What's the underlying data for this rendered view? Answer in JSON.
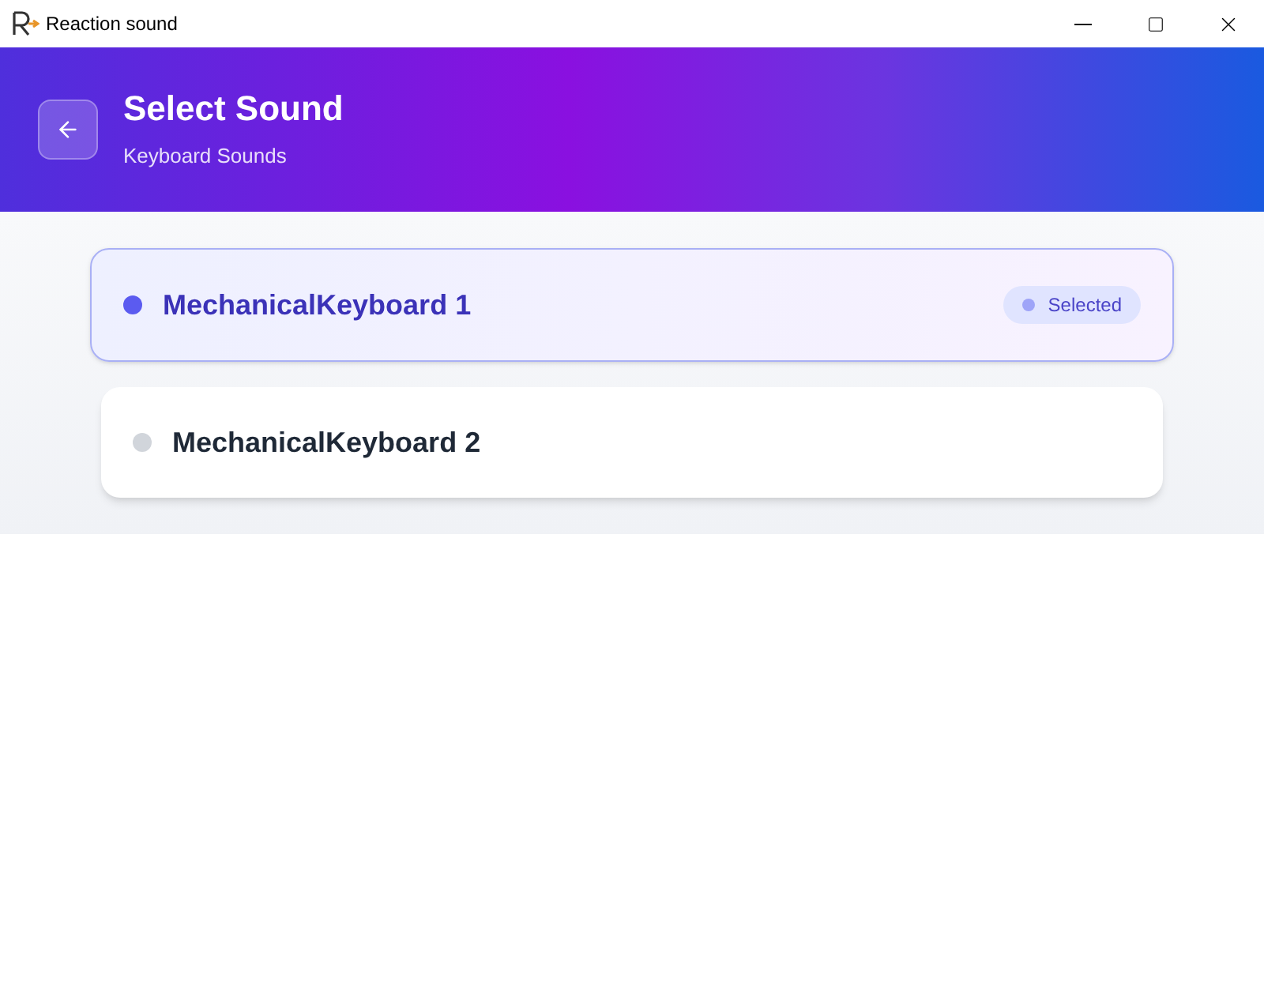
{
  "window": {
    "title": "Reaction sound"
  },
  "header": {
    "title": "Select Sound",
    "subtitle": "Keyboard Sounds"
  },
  "sounds": [
    {
      "name": "MechanicalKeyboard 1",
      "selected": true,
      "badge": "Selected"
    },
    {
      "name": "MechanicalKeyboard 2",
      "selected": false
    }
  ]
}
